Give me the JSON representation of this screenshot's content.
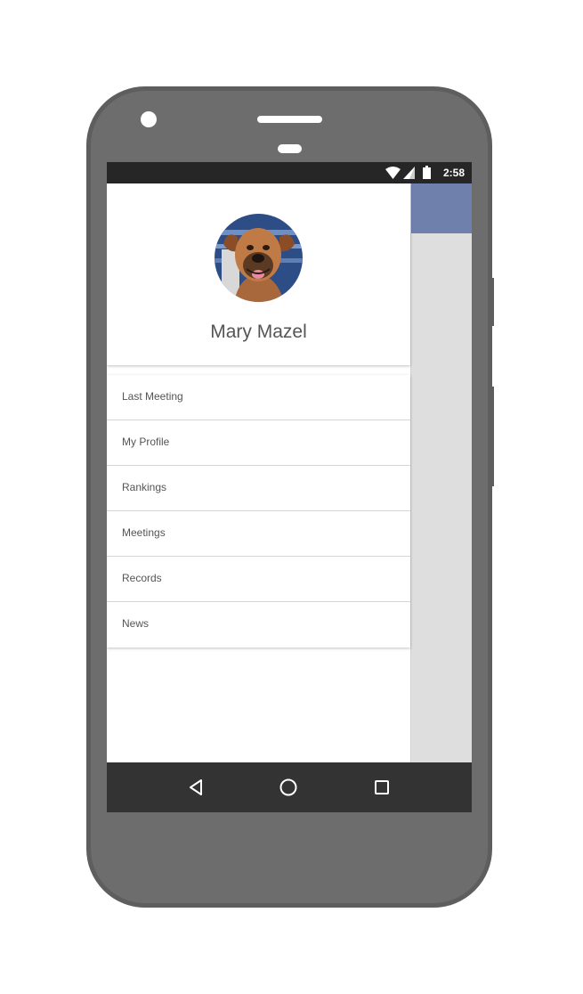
{
  "status_bar": {
    "time": "2:58",
    "icons": [
      "wifi-icon",
      "cell-signal-icon",
      "battery-icon"
    ]
  },
  "drawer": {
    "user_name": "Mary Mazel",
    "avatar": "dog-avatar",
    "menu": [
      {
        "label": "Last Meeting"
      },
      {
        "label": "My Profile"
      },
      {
        "label": "Rankings"
      },
      {
        "label": "Meetings"
      },
      {
        "label": "Records"
      },
      {
        "label": "News"
      }
    ]
  },
  "nav_bar": {
    "buttons": [
      "back-icon",
      "home-icon",
      "recents-icon"
    ]
  },
  "colors": {
    "app_bar": "#7080ad",
    "status_bar": "#262626",
    "nav_bar": "#333333",
    "phone_body": "#6d6d6d"
  }
}
